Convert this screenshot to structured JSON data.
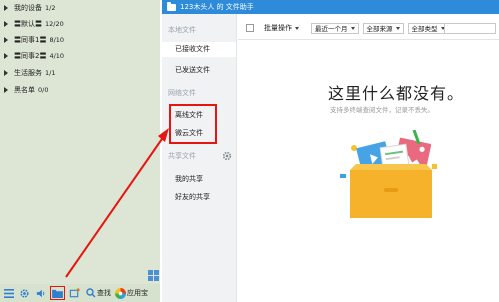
{
  "contacts": {
    "groups": [
      {
        "label": "我的设备",
        "count": "1/2"
      },
      {
        "label": "〓默认〓",
        "count": "12/20"
      },
      {
        "label": "〓同事1〓",
        "count": "8/10"
      },
      {
        "label": "〓同事2〓",
        "count": "4/10"
      },
      {
        "label": "生活服务",
        "count": "1/1"
      },
      {
        "label": "黑名单",
        "count": "0/0"
      }
    ],
    "toolbar": {
      "search_label": "查找",
      "app_label": "应用宝"
    }
  },
  "window": {
    "title": "123木头人 的 文件助手",
    "sidebar": {
      "local_section": "本地文件",
      "received": "已接收文件",
      "sent": "已发送文件",
      "network_section": "网络文件",
      "offline": "离线文件",
      "weiyun": "微云文件",
      "shared_section": "共享文件",
      "my_shared": "我的共享",
      "friends_shared": "好友的共享"
    },
    "filters": {
      "batch": "批量操作",
      "time": "最近一个月",
      "source": "全部来源",
      "type": "全部类型"
    },
    "empty": {
      "title": "这里什么都没有。",
      "subtitle": "支持多终端查阅文件，记录不丢失。"
    }
  },
  "colors": {
    "title_bar": "#2e8bd9",
    "highlight_red": "#e8140f",
    "contact_panel": "#dde6d5"
  },
  "icons": [
    "menu-icon",
    "gear-icon",
    "speaker-icon",
    "folder-icon",
    "screenshot-icon",
    "search-icon",
    "app-store-icon",
    "grid-icon",
    "folder-illustration"
  ]
}
